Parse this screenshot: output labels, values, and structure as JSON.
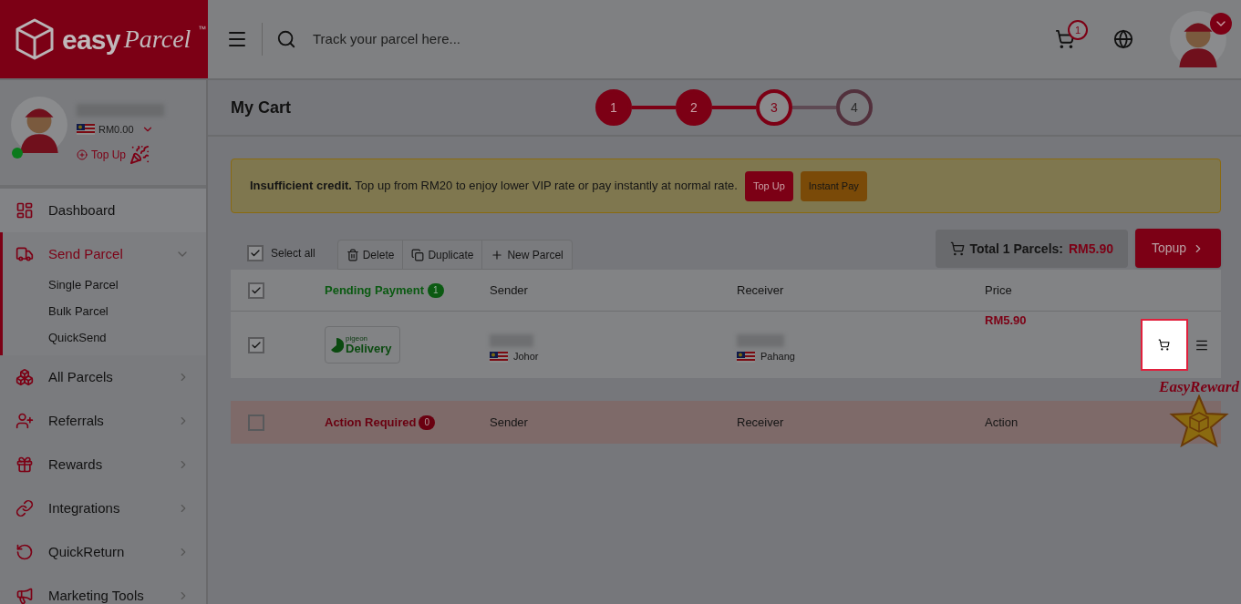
{
  "header": {
    "logo": {
      "brand": "easy",
      "script": "Parcel",
      "mark": "™"
    },
    "search": {
      "placeholder": "Track your parcel here..."
    },
    "cart_count": "1"
  },
  "profile": {
    "balance": "RM0.00",
    "top_up": "Top Up",
    "online": true
  },
  "nav": [
    {
      "label": "Dashboard",
      "selected": false
    },
    {
      "label": "Send Parcel",
      "selected": true,
      "expanded": true,
      "children": [
        {
          "label": "Single Parcel"
        },
        {
          "label": "Bulk Parcel"
        },
        {
          "label": "QuickSend"
        }
      ]
    },
    {
      "label": "All Parcels",
      "selected": false,
      "expanded": false
    },
    {
      "label": "Referrals",
      "selected": false,
      "expanded": false
    },
    {
      "label": "Rewards",
      "selected": false,
      "expanded": false
    },
    {
      "label": "Integrations",
      "selected": false,
      "expanded": false
    },
    {
      "label": "QuickReturn",
      "selected": false,
      "expanded": false
    },
    {
      "label": "Marketing Tools",
      "selected": false,
      "expanded": false
    }
  ],
  "page_title": "My Cart",
  "steps": [
    {
      "label": "1",
      "done": true,
      "selected": false
    },
    {
      "label": "2",
      "done": true,
      "selected": false
    },
    {
      "label": "3",
      "done": false,
      "selected": true
    },
    {
      "label": "4",
      "done": false,
      "selected": false
    }
  ],
  "alert": {
    "message": "**Insufficient credit.** Top up from RM20 to enjoy lower VIP rate or pay instantly at normal rate.",
    "buttons": [
      {
        "label": "Top Up",
        "kind": "primary"
      },
      {
        "label": "Instant Pay",
        "kind": "warning"
      }
    ]
  },
  "toolbar": {
    "select_all": {
      "label": "Select all",
      "checked": true
    },
    "actions": [
      "Delete",
      "Duplicate",
      "New Parcel"
    ],
    "total": {
      "label": "Total 1 Parcels:",
      "amount": "RM5.90"
    },
    "topup": "Topup"
  },
  "pending": {
    "title": "Pending Payment",
    "count": "1",
    "checked": true,
    "columns": [
      "Sender",
      "Receiver",
      "Price"
    ],
    "rows": [
      {
        "checked": true,
        "courier": {
          "small": "pigeon",
          "name": "Delivery"
        },
        "sender_state": "Johor",
        "receiver_state": "Pahang",
        "price": "RM5.90"
      }
    ]
  },
  "action_required": {
    "title": "Action Required",
    "count": "0",
    "checked": false,
    "columns": [
      "Sender",
      "Receiver",
      "Action"
    ]
  },
  "reward": "EasyReward"
}
